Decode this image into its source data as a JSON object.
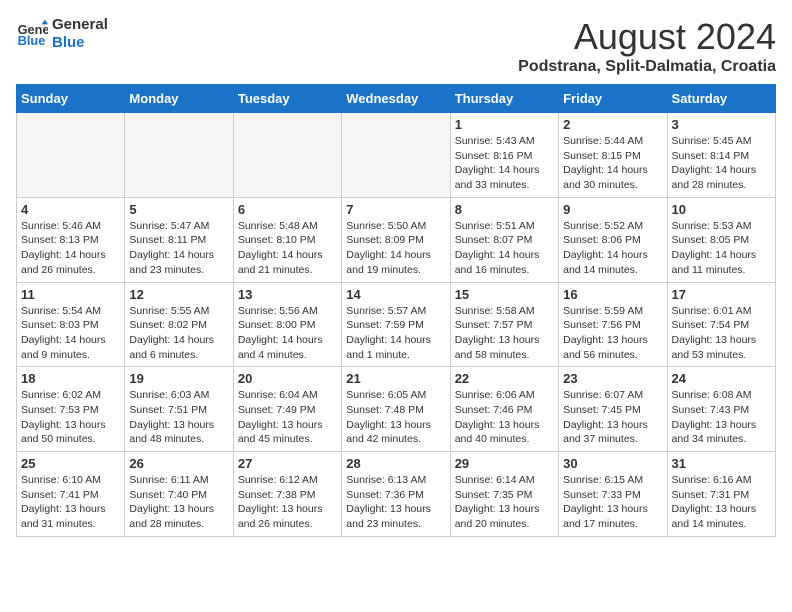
{
  "logo": {
    "line1": "General",
    "line2": "Blue"
  },
  "title": "August 2024",
  "subtitle": "Podstrana, Split-Dalmatia, Croatia",
  "weekdays": [
    "Sunday",
    "Monday",
    "Tuesday",
    "Wednesday",
    "Thursday",
    "Friday",
    "Saturday"
  ],
  "weeks": [
    [
      {
        "day": "",
        "info": ""
      },
      {
        "day": "",
        "info": ""
      },
      {
        "day": "",
        "info": ""
      },
      {
        "day": "",
        "info": ""
      },
      {
        "day": "1",
        "info": "Sunrise: 5:43 AM\nSunset: 8:16 PM\nDaylight: 14 hours\nand 33 minutes."
      },
      {
        "day": "2",
        "info": "Sunrise: 5:44 AM\nSunset: 8:15 PM\nDaylight: 14 hours\nand 30 minutes."
      },
      {
        "day": "3",
        "info": "Sunrise: 5:45 AM\nSunset: 8:14 PM\nDaylight: 14 hours\nand 28 minutes."
      }
    ],
    [
      {
        "day": "4",
        "info": "Sunrise: 5:46 AM\nSunset: 8:13 PM\nDaylight: 14 hours\nand 26 minutes."
      },
      {
        "day": "5",
        "info": "Sunrise: 5:47 AM\nSunset: 8:11 PM\nDaylight: 14 hours\nand 23 minutes."
      },
      {
        "day": "6",
        "info": "Sunrise: 5:48 AM\nSunset: 8:10 PM\nDaylight: 14 hours\nand 21 minutes."
      },
      {
        "day": "7",
        "info": "Sunrise: 5:50 AM\nSunset: 8:09 PM\nDaylight: 14 hours\nand 19 minutes."
      },
      {
        "day": "8",
        "info": "Sunrise: 5:51 AM\nSunset: 8:07 PM\nDaylight: 14 hours\nand 16 minutes."
      },
      {
        "day": "9",
        "info": "Sunrise: 5:52 AM\nSunset: 8:06 PM\nDaylight: 14 hours\nand 14 minutes."
      },
      {
        "day": "10",
        "info": "Sunrise: 5:53 AM\nSunset: 8:05 PM\nDaylight: 14 hours\nand 11 minutes."
      }
    ],
    [
      {
        "day": "11",
        "info": "Sunrise: 5:54 AM\nSunset: 8:03 PM\nDaylight: 14 hours\nand 9 minutes."
      },
      {
        "day": "12",
        "info": "Sunrise: 5:55 AM\nSunset: 8:02 PM\nDaylight: 14 hours\nand 6 minutes."
      },
      {
        "day": "13",
        "info": "Sunrise: 5:56 AM\nSunset: 8:00 PM\nDaylight: 14 hours\nand 4 minutes."
      },
      {
        "day": "14",
        "info": "Sunrise: 5:57 AM\nSunset: 7:59 PM\nDaylight: 14 hours\nand 1 minute."
      },
      {
        "day": "15",
        "info": "Sunrise: 5:58 AM\nSunset: 7:57 PM\nDaylight: 13 hours\nand 58 minutes."
      },
      {
        "day": "16",
        "info": "Sunrise: 5:59 AM\nSunset: 7:56 PM\nDaylight: 13 hours\nand 56 minutes."
      },
      {
        "day": "17",
        "info": "Sunrise: 6:01 AM\nSunset: 7:54 PM\nDaylight: 13 hours\nand 53 minutes."
      }
    ],
    [
      {
        "day": "18",
        "info": "Sunrise: 6:02 AM\nSunset: 7:53 PM\nDaylight: 13 hours\nand 50 minutes."
      },
      {
        "day": "19",
        "info": "Sunrise: 6:03 AM\nSunset: 7:51 PM\nDaylight: 13 hours\nand 48 minutes."
      },
      {
        "day": "20",
        "info": "Sunrise: 6:04 AM\nSunset: 7:49 PM\nDaylight: 13 hours\nand 45 minutes."
      },
      {
        "day": "21",
        "info": "Sunrise: 6:05 AM\nSunset: 7:48 PM\nDaylight: 13 hours\nand 42 minutes."
      },
      {
        "day": "22",
        "info": "Sunrise: 6:06 AM\nSunset: 7:46 PM\nDaylight: 13 hours\nand 40 minutes."
      },
      {
        "day": "23",
        "info": "Sunrise: 6:07 AM\nSunset: 7:45 PM\nDaylight: 13 hours\nand 37 minutes."
      },
      {
        "day": "24",
        "info": "Sunrise: 6:08 AM\nSunset: 7:43 PM\nDaylight: 13 hours\nand 34 minutes."
      }
    ],
    [
      {
        "day": "25",
        "info": "Sunrise: 6:10 AM\nSunset: 7:41 PM\nDaylight: 13 hours\nand 31 minutes."
      },
      {
        "day": "26",
        "info": "Sunrise: 6:11 AM\nSunset: 7:40 PM\nDaylight: 13 hours\nand 28 minutes."
      },
      {
        "day": "27",
        "info": "Sunrise: 6:12 AM\nSunset: 7:38 PM\nDaylight: 13 hours\nand 26 minutes."
      },
      {
        "day": "28",
        "info": "Sunrise: 6:13 AM\nSunset: 7:36 PM\nDaylight: 13 hours\nand 23 minutes."
      },
      {
        "day": "29",
        "info": "Sunrise: 6:14 AM\nSunset: 7:35 PM\nDaylight: 13 hours\nand 20 minutes."
      },
      {
        "day": "30",
        "info": "Sunrise: 6:15 AM\nSunset: 7:33 PM\nDaylight: 13 hours\nand 17 minutes."
      },
      {
        "day": "31",
        "info": "Sunrise: 6:16 AM\nSunset: 7:31 PM\nDaylight: 13 hours\nand 14 minutes."
      }
    ]
  ]
}
